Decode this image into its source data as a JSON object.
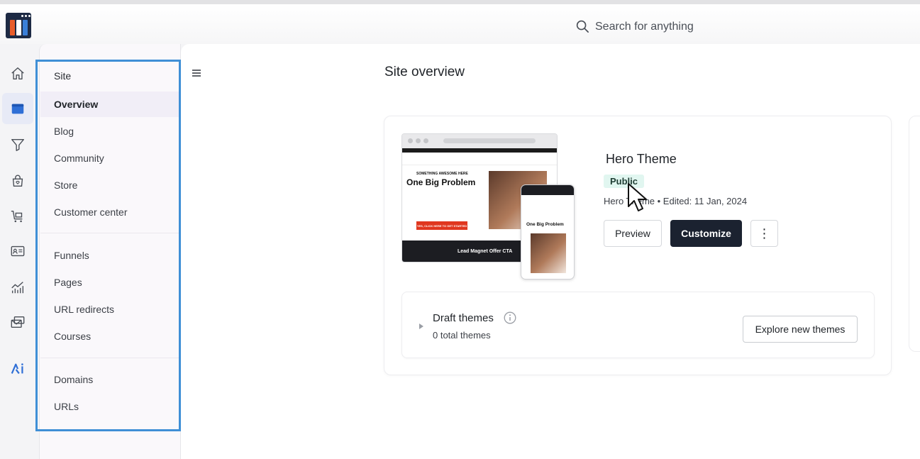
{
  "header": {
    "search_placeholder": "Search for anything"
  },
  "rail": {
    "items": [
      {
        "icon": "home-icon"
      },
      {
        "icon": "site-icon",
        "active": true
      },
      {
        "icon": "funnel-icon"
      },
      {
        "icon": "store-icon"
      },
      {
        "icon": "cart-icon"
      },
      {
        "icon": "contacts-icon"
      },
      {
        "icon": "analytics-icon"
      },
      {
        "icon": "email-icon"
      },
      {
        "icon": "ai-icon"
      }
    ]
  },
  "sidebar": {
    "section_title": "Site",
    "items": [
      {
        "label": "Overview",
        "active": true
      },
      {
        "label": "Blog"
      },
      {
        "label": "Community"
      },
      {
        "label": "Store"
      },
      {
        "label": "Customer center"
      },
      {
        "label": "Funnels"
      },
      {
        "label": "Pages"
      },
      {
        "label": "URL redirects"
      },
      {
        "label": "Courses"
      },
      {
        "label": "Domains"
      },
      {
        "label": "URLs"
      }
    ]
  },
  "main": {
    "title": "Site overview",
    "theme": {
      "name": "Hero Theme",
      "status": "Public",
      "meta": "Hero Theme • Edited: 11 Jan, 2024",
      "preview_label": "Preview",
      "customize_label": "Customize",
      "more_label": "⋮",
      "thumbnail": {
        "headline": "One Big Problem",
        "kicker": "SOMETHING AWESOME HERE",
        "cta": "YES, CLICK HERE TO GET STARTED",
        "banner": "Lead Magnet Offer CTA",
        "phone_headline": "One Big Problem"
      }
    },
    "drafts": {
      "title": "Draft themes",
      "count_text": "0 total themes",
      "explore_label": "Explore new themes"
    }
  },
  "colors": {
    "accent_dark": "#1b2230",
    "badge_bg": "#e1f6f0",
    "highlight_border": "#3f8fd6",
    "active_rail": "#2f6fd6"
  }
}
